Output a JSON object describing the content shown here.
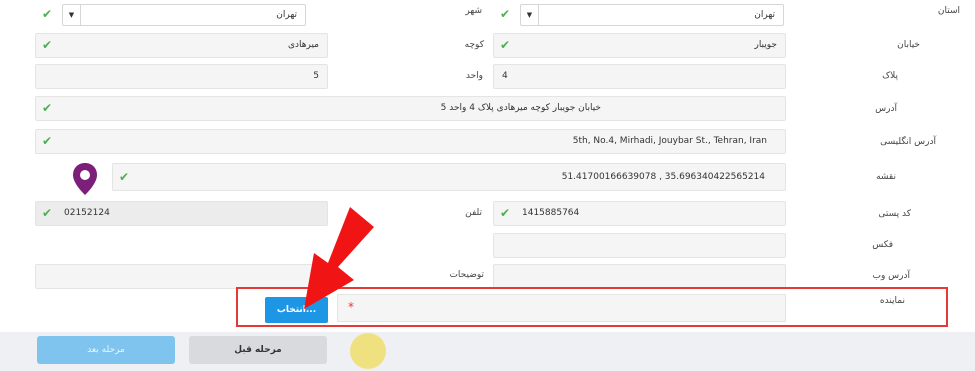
{
  "labels": {
    "province": "استان",
    "city": "شهر",
    "street": "خیابان",
    "alley": "کوچه",
    "plaque": "پلاک",
    "unit": "واحد",
    "address": "آدرس",
    "address_en": "آدرس انگلیسی",
    "map": "نقشه",
    "postal_code": "کد پستی",
    "phone": "تلفن",
    "fax": "فکس",
    "website": "آدرس وب",
    "description": "توضیحات",
    "representative": "نماینده"
  },
  "values": {
    "province": "تهران",
    "city": "تهران",
    "street": "جویبار",
    "alley": "میرهادی",
    "plaque": "4",
    "unit": "5",
    "address": "خیابان جویبار کوچه میرهادی پلاک 4 واحد 5",
    "address_en": "5th, No.4, Mirhadi, Jouybar St., Tehran, Iran",
    "map": "51.41700166639078 , 35.696340422565214",
    "postal_code": "1415885764",
    "phone": "02152124",
    "fax": "",
    "website": "",
    "description": "",
    "representative": ""
  },
  "required_mark": "*",
  "buttons": {
    "choose": "انتخاب...",
    "previous": "مرحله قبل",
    "next": "مرحله بعد"
  },
  "icons": {
    "check": "✔",
    "caret": "▼"
  },
  "colors": {
    "check": "#4caf50",
    "highlight_border": "#e53935",
    "choose_button": "#1e96e6",
    "next_button": "#7fc4ef",
    "pin": "#7b1f7a",
    "arrow": "#f01414"
  }
}
